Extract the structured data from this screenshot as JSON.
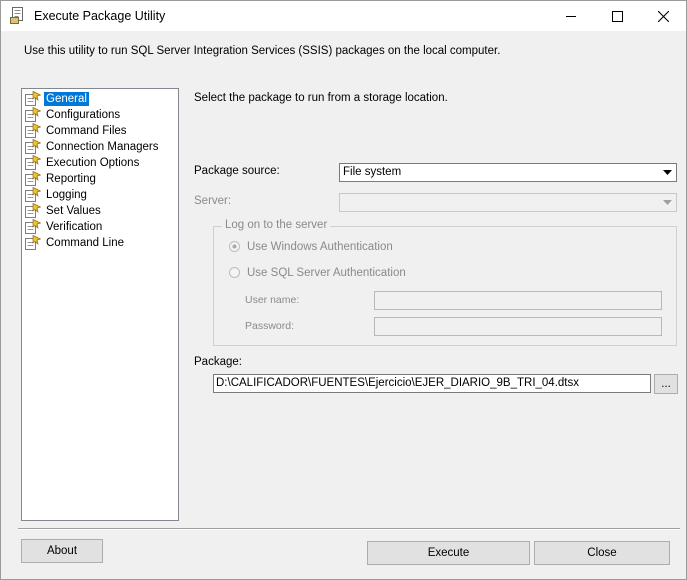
{
  "window": {
    "title": "Execute Package Utility",
    "app_icon": "package-utility-icon"
  },
  "description": "Use this utility to run SQL Server Integration Services (SSIS) packages on the local computer.",
  "nav": {
    "item_icon": "page-settings-icon",
    "items": [
      {
        "label": "General",
        "selected": true
      },
      {
        "label": "Configurations"
      },
      {
        "label": "Command Files"
      },
      {
        "label": "Connection Managers"
      },
      {
        "label": "Execution Options"
      },
      {
        "label": "Reporting"
      },
      {
        "label": "Logging"
      },
      {
        "label": "Set Values"
      },
      {
        "label": "Verification"
      },
      {
        "label": "Command Line"
      }
    ]
  },
  "general": {
    "prompt": "Select the package to run from a storage location.",
    "package_source_label": "Package source:",
    "package_source_value": "File system",
    "server_label": "Server:",
    "server_value": "",
    "logon_group_title": "Log on to the server",
    "windows_auth_label": "Use Windows Authentication",
    "sql_auth_label": "Use SQL Server Authentication",
    "username_label": "User name:",
    "password_label": "Password:",
    "package_label": "Package:",
    "package_path": "D:\\CALIFICADOR\\FUENTES\\Ejercicio\\EJER_DIARIO_9B_TRI_04.dtsx",
    "browse_label": "..."
  },
  "buttons": {
    "about": "About",
    "execute": "Execute",
    "close": "Close"
  }
}
